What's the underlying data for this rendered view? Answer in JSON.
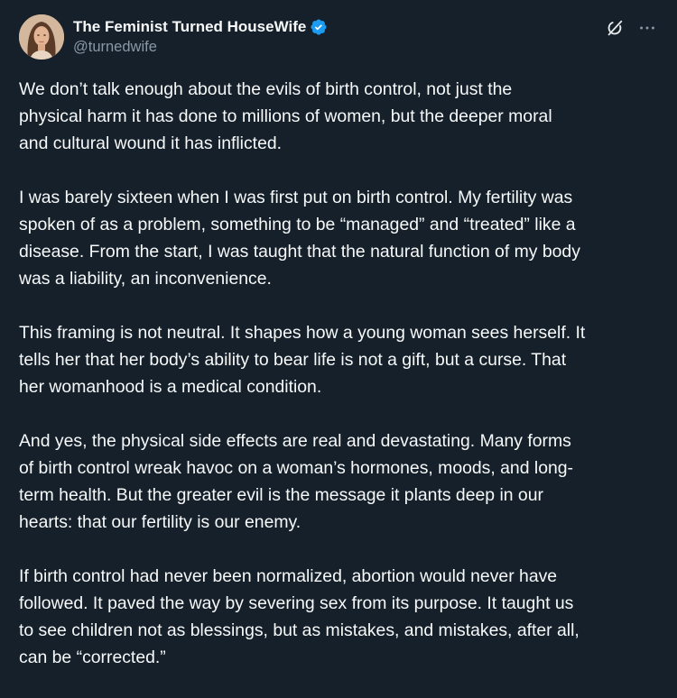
{
  "author": {
    "display_name": "The Feminist Turned HouseWife",
    "handle": "@turnedwife",
    "verified_icon": "verified-badge-icon",
    "avatar_icon": "avatar-portrait"
  },
  "actions": {
    "grok_icon": "grok-icon",
    "more_icon": "more-options-icon"
  },
  "colors": {
    "background": "#15202b",
    "text": "#f7f9f9",
    "secondary_text": "#8b98a5",
    "verified_blue": "#1d9bf0"
  },
  "post": {
    "paragraphs": [
      "We don’t talk enough about the evils of birth control, not just the\nphysical harm it has done to millions of women, but the deeper moral\nand cultural wound it has inflicted.",
      "I was barely sixteen when I was first put on birth control. My fertility was\nspoken of as a problem, something to be “managed” and “treated” like a\ndisease. From the start, I was taught that the natural function of my body\nwas a liability, an inconvenience.",
      "This framing is not neutral. It shapes how a young woman sees herself. It\ntells her that her body’s ability to bear life is not a gift, but a curse. That\nher womanhood is a medical condition.",
      "And yes, the physical side effects are real and devastating. Many forms\nof birth control wreak havoc on a woman’s hormones, moods, and long-\nterm health. But the greater evil is the message it plants deep in our\nhearts: that our fertility is our enemy.",
      "If birth control had never been normalized, abortion would never have\nfollowed. It paved the way by severing sex from its purpose. It taught us\nto see children not as blessings, but as mistakes, and mistakes, after all,\ncan be “corrected.”"
    ]
  }
}
